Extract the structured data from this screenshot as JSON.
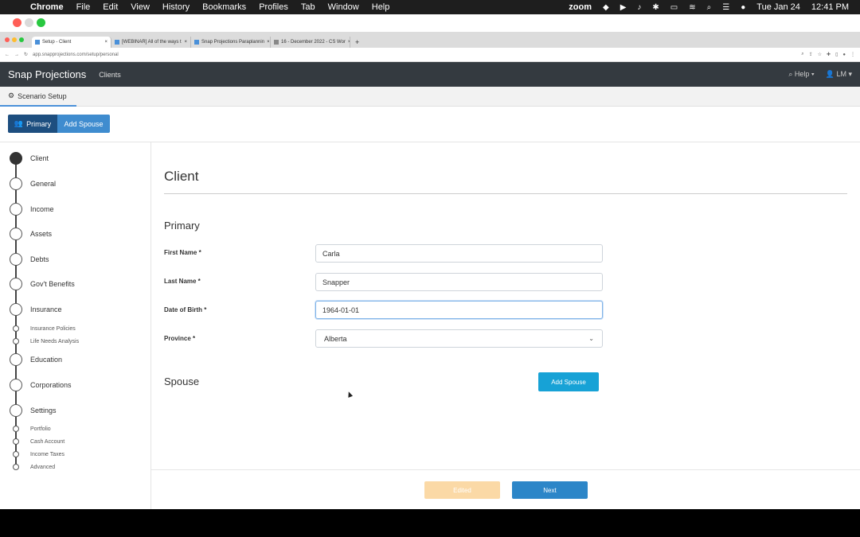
{
  "menubar": {
    "app": "Chrome",
    "items": [
      "File",
      "Edit",
      "View",
      "History",
      "Bookmarks",
      "Profiles",
      "Tab",
      "Window",
      "Help"
    ],
    "zoom": "zoom",
    "date": "Tue Jan 24",
    "time": "12:41 PM"
  },
  "browser": {
    "tabs": [
      {
        "label": "Setup - Client",
        "active": true
      },
      {
        "label": "[WEBINAR] All of the ways t",
        "active": false
      },
      {
        "label": "Snap Projections Paraplannin",
        "active": false
      },
      {
        "label": "16 - December 2022 - CS Wor",
        "active": false
      }
    ],
    "new_tab": "+",
    "url": "app.snapprojections.com/setup/personal"
  },
  "navbar": {
    "brand": "Snap Projections",
    "clients": "Clients",
    "help": "Help",
    "user": "LM"
  },
  "subnav": {
    "scenario": "Scenario Setup"
  },
  "persons": {
    "primary": "Primary",
    "add_spouse": "Add Spouse"
  },
  "steps": [
    {
      "label": "Client",
      "filled": true
    },
    {
      "label": "General"
    },
    {
      "label": "Income"
    },
    {
      "label": "Assets"
    },
    {
      "label": "Debts"
    },
    {
      "label": "Gov't Benefits"
    },
    {
      "label": "Insurance"
    },
    {
      "label": "Education"
    },
    {
      "label": "Corporations"
    },
    {
      "label": "Settings"
    }
  ],
  "substeps": {
    "insurance": [
      "Insurance Policies",
      "Life Needs Analysis"
    ],
    "settings": [
      "Portfolio",
      "Cash Account",
      "Income Taxes",
      "Advanced"
    ]
  },
  "form": {
    "title": "Client",
    "primary_heading": "Primary",
    "first_name_label": "First Name *",
    "first_name_value": "Carla",
    "last_name_label": "Last Name *",
    "last_name_value": "Snapper",
    "dob_label": "Date of Birth *",
    "dob_value": "1964-01-01",
    "province_label": "Province *",
    "province_value": "Alberta",
    "spouse_heading": "Spouse",
    "add_spouse_button": "Add Spouse"
  },
  "footer": {
    "edited": "Edited",
    "next": "Next"
  },
  "colors": {
    "navbar": "#343a40",
    "primary_btn": "#1d4e7f",
    "accent": "#17a2d6",
    "next": "#2c86c8",
    "edited": "#fbd9a6"
  }
}
